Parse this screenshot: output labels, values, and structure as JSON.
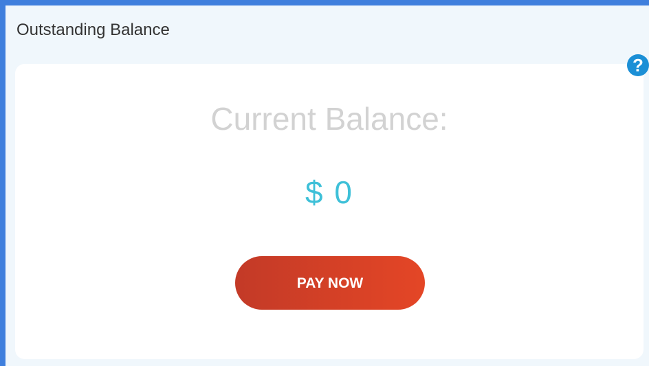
{
  "panel": {
    "title": "Outstanding Balance",
    "help_icon": "help-circle-icon",
    "help_glyph": "?"
  },
  "balance": {
    "label": "Current Balance:",
    "amount": "$ 0"
  },
  "actions": {
    "pay_now_label": "PAY NOW"
  },
  "colors": {
    "frame": "#3f7fdd",
    "panel_background": "#f0f7fc",
    "card_background": "#ffffff",
    "label_text": "#d2d2d2",
    "amount_text": "#3ec0d8",
    "button_gradient_start": "#c33a27",
    "button_gradient_end": "#e44626",
    "help_icon": "#1b8fd6"
  }
}
